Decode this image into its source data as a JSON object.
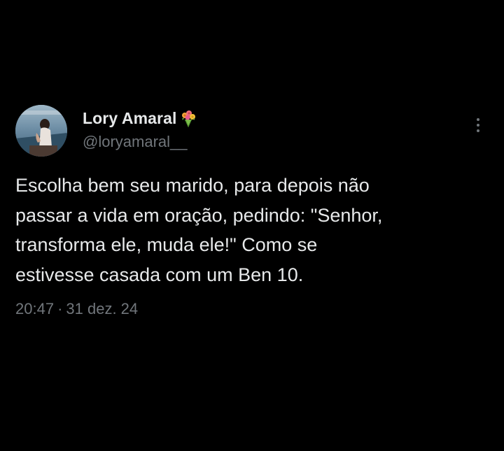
{
  "author": {
    "display_name": "Lory Amaral",
    "name_emoji_icon": "bouquet-icon",
    "handle": "@loryamaral__"
  },
  "tweet": {
    "lines": [
      "Escolha bem seu marido, para depois não",
      "passar a vida em oração, pedindo: \"Senhor,",
      "transforma ele, muda ele!\" Como se",
      "estivesse casada com um Ben 10."
    ],
    "time": "20:47",
    "separator": "·",
    "date": "31 dez. 24"
  },
  "colors": {
    "background": "#000000",
    "primary_text": "#e7e9ea",
    "secondary_text": "#71767b"
  }
}
